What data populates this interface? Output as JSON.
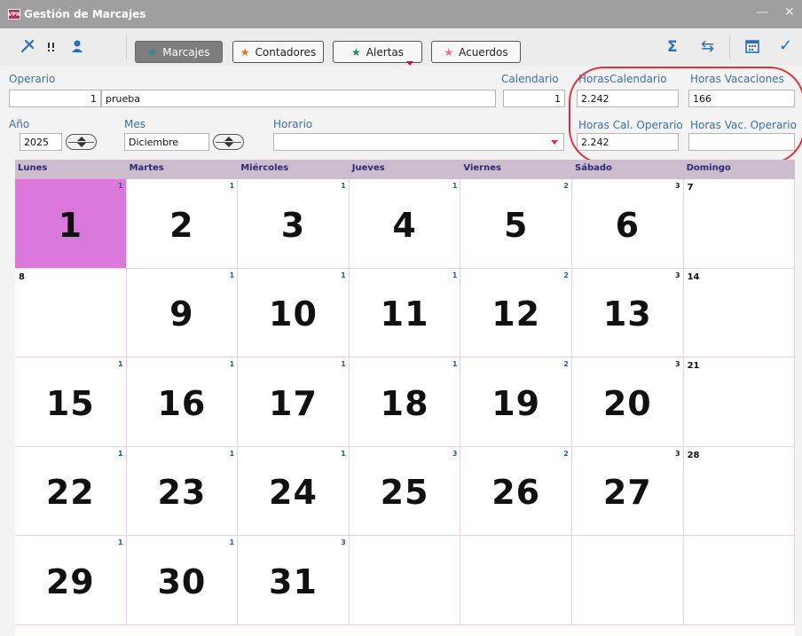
{
  "window": {
    "title": "Gestión de Marcajes",
    "logo_text": "VPN",
    "minimize": "—",
    "close": "✕"
  },
  "toolbar": {
    "tabs": [
      {
        "label": "Marcajes",
        "star_color": "#2a8a9a",
        "active": true
      },
      {
        "label": "Contadores",
        "star_color": "#e07020",
        "active": false
      },
      {
        "label": "Alertas",
        "star_color": "#1f8a5a",
        "active": false
      },
      {
        "label": "Acuerdos",
        "star_color": "#e86aa0",
        "active": false
      }
    ],
    "icons": [
      "settings-icon",
      "pin-icon",
      "user-icon",
      "sigma-icon",
      "swap-icon",
      "calendar-icon",
      "check-icon"
    ],
    "sigma_glyph": "Σ",
    "swap_glyph": "⇆",
    "check_glyph": "✓"
  },
  "form": {
    "operario_label": "Operario",
    "operario_id": "1",
    "operario_name": "prueba",
    "calendario_label": "Calendario",
    "calendario_value": "1",
    "horas_calendario_label": "HorasCalendario",
    "horas_calendario_value": "2.242",
    "horas_vacaciones_label": "Horas Vacaciones",
    "horas_vacaciones_value": "166",
    "anio_label": "Año",
    "anio_value": "2025",
    "mes_label": "Mes",
    "mes_value": "Diciembre",
    "horario_label": "Horario",
    "horario_value": "",
    "horas_cal_operario_label": "Horas Cal. Operario",
    "horas_cal_operario_value": "2.242",
    "horas_vac_operario_label": "Horas Vac. Operario",
    "horas_vac_operario_value": ""
  },
  "calendar": {
    "weekdays": [
      "Lunes",
      "Martes",
      "Miércoles",
      "Jueves",
      "Viernes",
      "Sábado",
      "Domingo"
    ],
    "weeks": [
      [
        {
          "day": "1",
          "badge": "1",
          "style": "big",
          "highlight": true
        },
        {
          "day": "2",
          "badge": "1",
          "style": "big"
        },
        {
          "day": "3",
          "badge": "1",
          "style": "big"
        },
        {
          "day": "4",
          "badge": "1",
          "style": "big"
        },
        {
          "day": "5",
          "badge": "2",
          "style": "big"
        },
        {
          "day": "6",
          "badge": "3",
          "style": "big"
        },
        {
          "day": "7",
          "badge": "",
          "style": "small"
        }
      ],
      [
        {
          "day": "8",
          "badge": "",
          "style": "small"
        },
        {
          "day": "9",
          "badge": "1",
          "style": "big"
        },
        {
          "day": "10",
          "badge": "1",
          "style": "big"
        },
        {
          "day": "11",
          "badge": "1",
          "style": "big"
        },
        {
          "day": "12",
          "badge": "2",
          "style": "big"
        },
        {
          "day": "13",
          "badge": "3",
          "style": "big"
        },
        {
          "day": "14",
          "badge": "",
          "style": "small"
        }
      ],
      [
        {
          "day": "15",
          "badge": "1",
          "style": "big"
        },
        {
          "day": "16",
          "badge": "1",
          "style": "big"
        },
        {
          "day": "17",
          "badge": "1",
          "style": "big"
        },
        {
          "day": "18",
          "badge": "1",
          "style": "big"
        },
        {
          "day": "19",
          "badge": "2",
          "style": "big"
        },
        {
          "day": "20",
          "badge": "3",
          "style": "big"
        },
        {
          "day": "21",
          "badge": "",
          "style": "small"
        }
      ],
      [
        {
          "day": "22",
          "badge": "1",
          "style": "big"
        },
        {
          "day": "23",
          "badge": "1",
          "style": "big"
        },
        {
          "day": "24",
          "badge": "1",
          "style": "big"
        },
        {
          "day": "25",
          "badge": "3",
          "style": "big"
        },
        {
          "day": "26",
          "badge": "2",
          "style": "big"
        },
        {
          "day": "27",
          "badge": "3",
          "style": "big"
        },
        {
          "day": "28",
          "badge": "",
          "style": "small"
        }
      ],
      [
        {
          "day": "29",
          "badge": "1",
          "style": "big"
        },
        {
          "day": "30",
          "badge": "1",
          "style": "big"
        },
        {
          "day": "31",
          "badge": "3",
          "style": "big"
        },
        {
          "day": "",
          "badge": "",
          "style": "empty"
        },
        {
          "day": "",
          "badge": "",
          "style": "empty"
        },
        {
          "day": "",
          "badge": "",
          "style": "empty"
        },
        {
          "day": "",
          "badge": "",
          "style": "empty"
        }
      ]
    ]
  },
  "colors": {
    "highlight_day": "#db78db",
    "header_bg": "#cdbccd",
    "annotation_ellipse": "#e2303a"
  }
}
